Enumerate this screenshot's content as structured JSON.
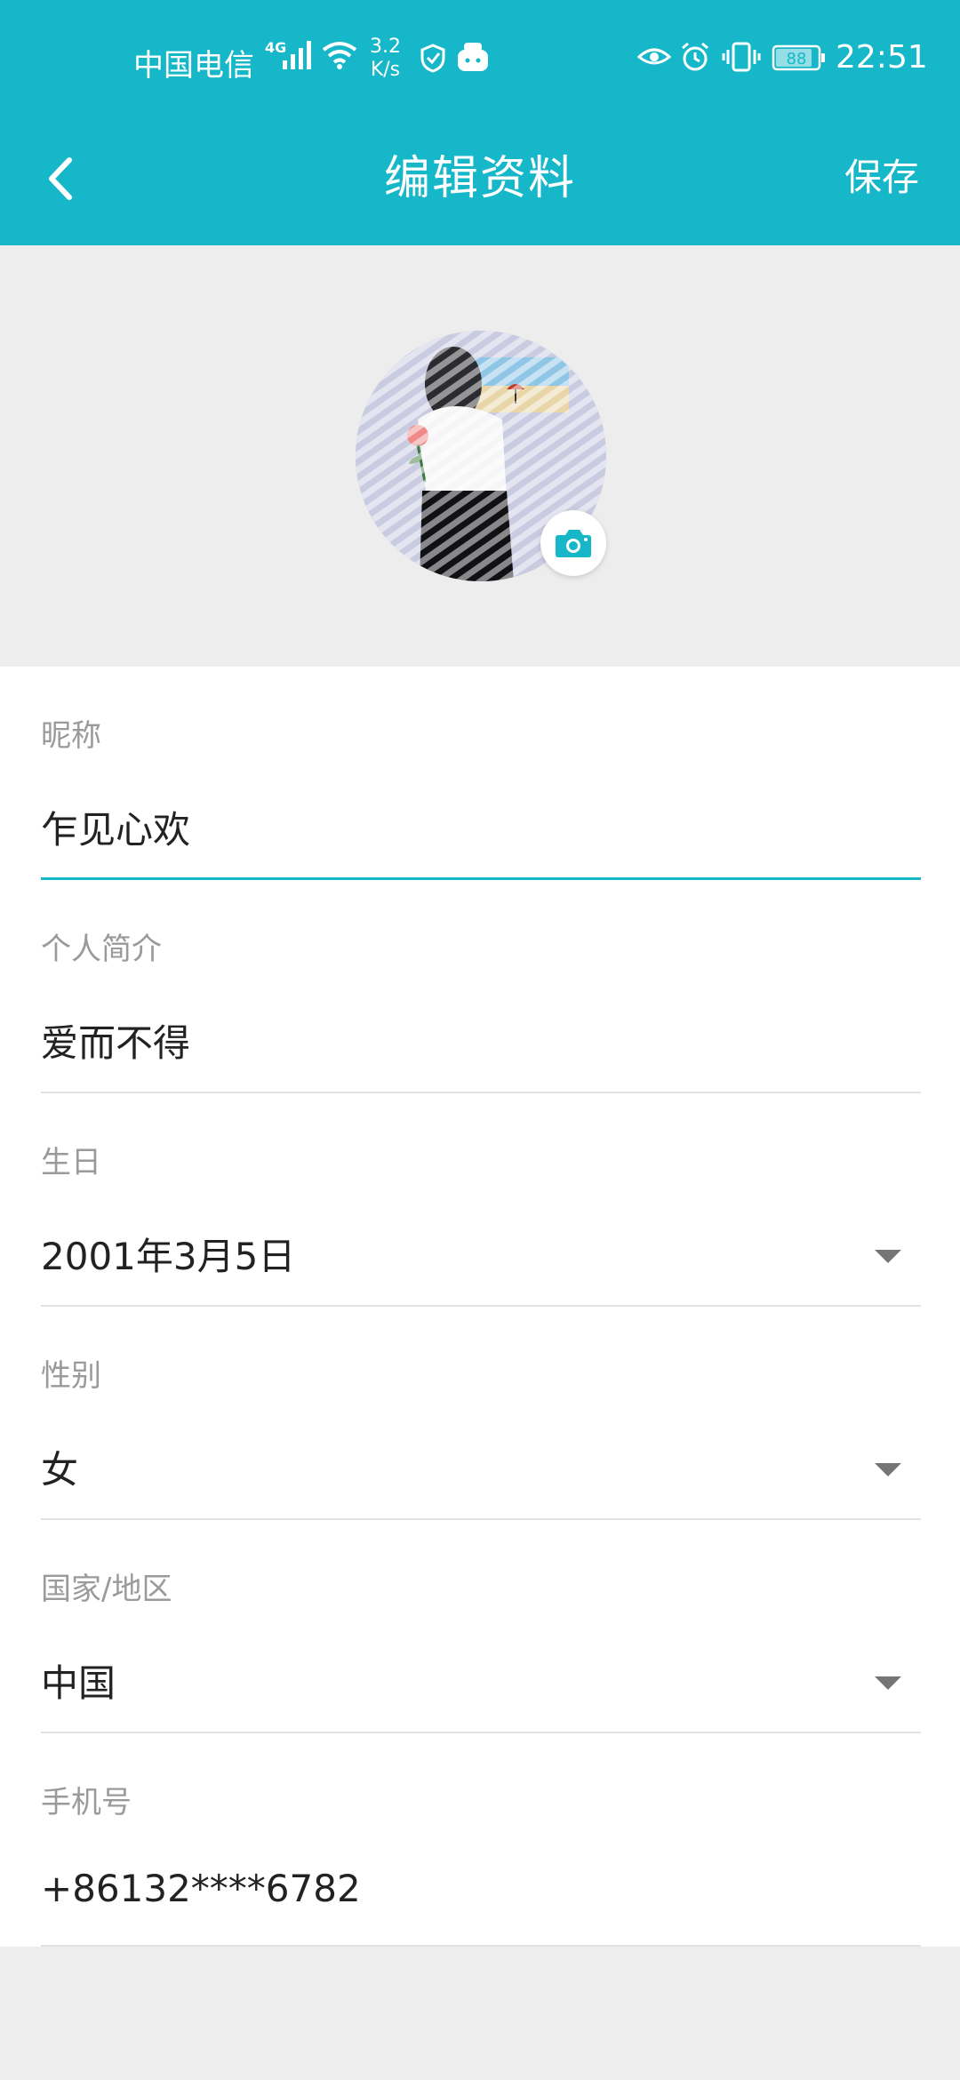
{
  "status_bar": {
    "carrier": "中国电信",
    "network": "4G",
    "speed_value": "3.2",
    "speed_unit": "K/s",
    "battery": "88",
    "time": "22:51"
  },
  "header": {
    "title": "编辑资料",
    "save_label": "保存"
  },
  "colors": {
    "accent": "#16b7c8",
    "background": "#ededed",
    "label_gray": "#9a9a9a"
  },
  "form": {
    "nickname": {
      "label": "昵称",
      "value": "乍见心欢"
    },
    "bio": {
      "label": "个人简介",
      "value": "爱而不得"
    },
    "birthday": {
      "label": "生日",
      "value": "2001年3月5日"
    },
    "gender": {
      "label": "性别",
      "value": "女"
    },
    "region": {
      "label": "国家/地区",
      "value": "中国"
    },
    "phone": {
      "label": "手机号",
      "value": "+86132****6782"
    }
  }
}
